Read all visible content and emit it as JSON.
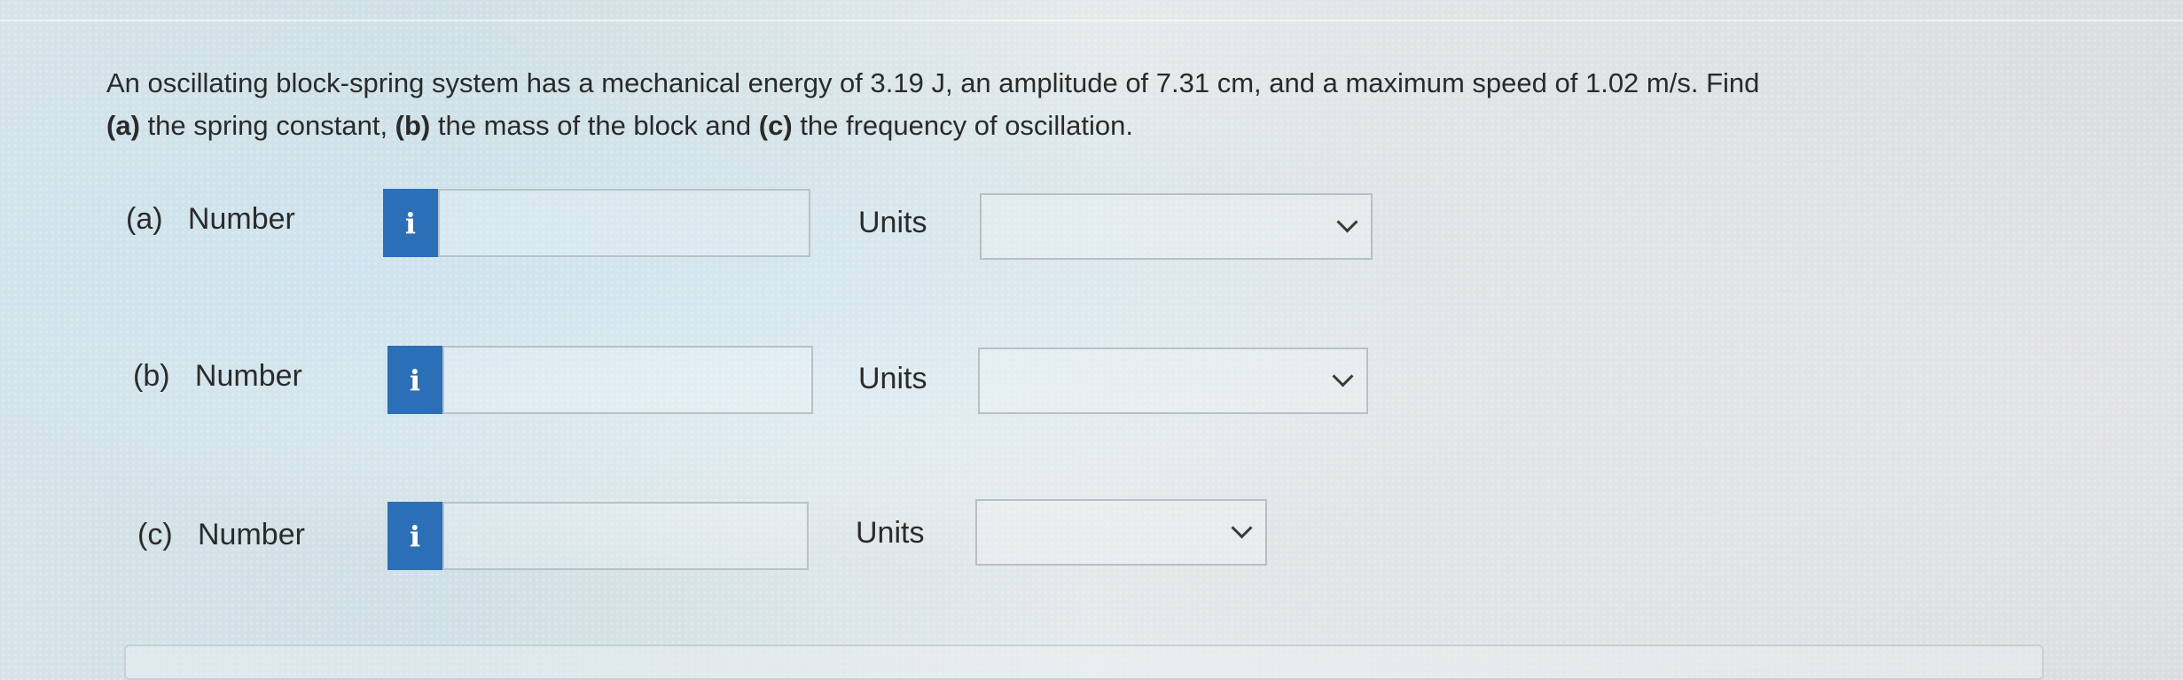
{
  "question": {
    "text_1": "An oscillating block-spring system has a mechanical energy of 3.19 J, an amplitude of 7.31 cm, and a maximum speed of 1.02 m/s. Find",
    "part_a_tag": "(a)",
    "text_2": " the spring constant, ",
    "part_b_tag": "(b)",
    "text_3": " the mass of the block and ",
    "part_c_tag": "(c)",
    "text_4": " the frequency of oscillation."
  },
  "rows": [
    {
      "part": "(a)",
      "number_label": "Number",
      "info_icon": "i",
      "number_value": "",
      "units_label": "Units",
      "units_selected": ""
    },
    {
      "part": "(b)",
      "number_label": "Number",
      "info_icon": "i",
      "number_value": "",
      "units_label": "Units",
      "units_selected": ""
    },
    {
      "part": "(c)",
      "number_label": "Number",
      "info_icon": "i",
      "number_value": "",
      "units_label": "Units",
      "units_selected": ""
    }
  ],
  "colors": {
    "info_button": "#2b6fb7",
    "text": "#2b2b2b",
    "field_border": "#b8c2c7"
  },
  "icons": {
    "info": "info-icon",
    "dropdown": "chevron-down-icon"
  }
}
